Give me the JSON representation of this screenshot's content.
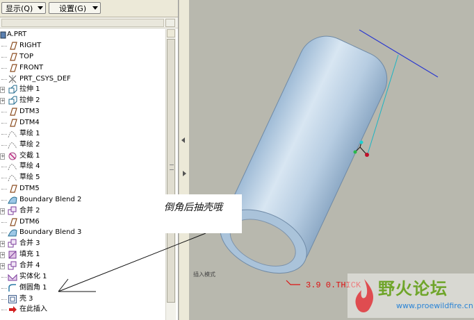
{
  "toolbar": {
    "show_label": "显示(Q)",
    "settings_label": "设置(G)"
  },
  "tree": {
    "root": "A.PRT",
    "items": [
      {
        "label": "RIGHT",
        "icon": "datum-plane-icon",
        "expandable": false
      },
      {
        "label": "TOP",
        "icon": "datum-plane-icon",
        "expandable": false
      },
      {
        "label": "FRONT",
        "icon": "datum-plane-icon",
        "expandable": false
      },
      {
        "label": "PRT_CSYS_DEF",
        "icon": "csys-icon",
        "expandable": false
      },
      {
        "label": "拉伸 1",
        "icon": "extrude-icon",
        "expandable": true
      },
      {
        "label": "拉伸 2",
        "icon": "extrude-icon",
        "expandable": true
      },
      {
        "label": "DTM3",
        "icon": "datum-plane-icon",
        "expandable": false
      },
      {
        "label": "DTM4",
        "icon": "datum-plane-icon",
        "expandable": false
      },
      {
        "label": "草绘 1",
        "icon": "sketch-icon",
        "expandable": false
      },
      {
        "label": "草绘 2",
        "icon": "sketch-icon",
        "expandable": false
      },
      {
        "label": "交截 1",
        "icon": "intersect-icon",
        "expandable": true
      },
      {
        "label": "草绘 4",
        "icon": "sketch-icon",
        "expandable": false
      },
      {
        "label": "草绘 5",
        "icon": "sketch-icon",
        "expandable": false
      },
      {
        "label": "DTM5",
        "icon": "datum-plane-icon",
        "expandable": false
      },
      {
        "label": "Boundary Blend 2",
        "icon": "boundary-blend-icon",
        "expandable": false
      },
      {
        "label": "合并 2",
        "icon": "merge-icon",
        "expandable": true
      },
      {
        "label": "DTM6",
        "icon": "datum-plane-icon",
        "expandable": false
      },
      {
        "label": "Boundary Blend 3",
        "icon": "boundary-blend-icon",
        "expandable": false
      },
      {
        "label": "合并 3",
        "icon": "merge-icon",
        "expandable": true
      },
      {
        "label": "填充 1",
        "icon": "fill-icon",
        "expandable": true
      },
      {
        "label": "合并 4",
        "icon": "merge-icon",
        "expandable": true
      },
      {
        "label": "实体化 1",
        "icon": "solidify-icon",
        "expandable": false
      },
      {
        "label": "倒圆角 1",
        "icon": "round-icon",
        "expandable": false
      },
      {
        "label": "壳 3",
        "icon": "shell-icon",
        "expandable": false
      },
      {
        "label": "在此插入",
        "icon": "insert-here-icon",
        "expandable": false
      }
    ]
  },
  "annotation": {
    "text": "倒角后抽壳哦"
  },
  "viewport": {
    "insert_mode_label": "插入模式",
    "dimension_text": "3.9 0.THICK"
  },
  "watermark": {
    "title": "野火论坛",
    "url": "www.proewildfire.cn"
  },
  "colors": {
    "viewport_bg": "#b8b8ae",
    "model_fill": "#c8daea",
    "accent_red": "#dd1111",
    "watermark_green": "#6fa52a",
    "watermark_blue": "#2a84d6"
  }
}
